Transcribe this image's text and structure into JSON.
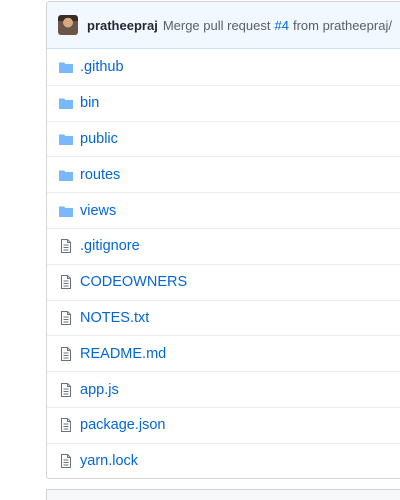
{
  "commit": {
    "author": "pratheepraj",
    "message_prefix": "Merge pull request",
    "pr_number": "#4",
    "message_suffix": "from pratheepraj/"
  },
  "files": [
    {
      "name": ".github",
      "type": "folder",
      "icon": "folder-icon"
    },
    {
      "name": "bin",
      "type": "folder",
      "icon": "folder-icon"
    },
    {
      "name": "public",
      "type": "folder",
      "icon": "folder-icon"
    },
    {
      "name": "routes",
      "type": "folder",
      "icon": "folder-icon"
    },
    {
      "name": "views",
      "type": "folder",
      "icon": "folder-icon"
    },
    {
      "name": ".gitignore",
      "type": "file",
      "icon": "file-icon"
    },
    {
      "name": "CODEOWNERS",
      "type": "file",
      "icon": "file-icon"
    },
    {
      "name": "NOTES.txt",
      "type": "file",
      "icon": "file-icon"
    },
    {
      "name": "README.md",
      "type": "file",
      "icon": "file-icon"
    },
    {
      "name": "app.js",
      "type": "file",
      "icon": "file-icon"
    },
    {
      "name": "package.json",
      "type": "file",
      "icon": "file-icon"
    },
    {
      "name": "yarn.lock",
      "type": "file",
      "icon": "file-icon"
    }
  ],
  "colors": {
    "link": "#0366d6",
    "folder_icon": "#79b8ff",
    "file_icon": "#6a737d",
    "commit_bg": "#f1f8ff"
  }
}
